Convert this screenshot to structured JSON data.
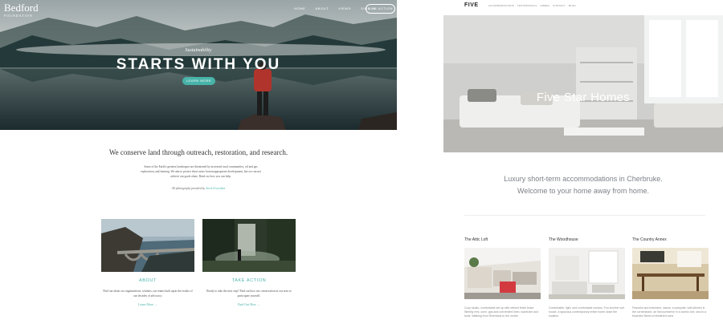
{
  "left_site": {
    "logo": {
      "name": "Bedford",
      "sub": "FOUNDATION"
    },
    "nav": [
      "HOME",
      "ABOUT",
      "VIEWS",
      "SIGN IN"
    ],
    "give_button": "GIVE ACTION",
    "hero": {
      "kicker": "Sustainability",
      "title": "STARTS WITH YOU",
      "cta": "LEARN MORE"
    },
    "mission": "We conserve land through outreach, restoration, and research.",
    "intro": "Some of the Earth's greatest landscapes are threatened by increased rural communities, oil and gas exploration, and farming. We aim to protect these areas from inappropriate development, but we can not achieve our goals alone. Read on; how you can help.",
    "credit": {
      "text": "All photography provided by",
      "link": "Jared Givernikot"
    },
    "cards": [
      {
        "title": "ABOUT",
        "text": "Find out about our organizations, scholars, our teams built upon the results of our decades of advocacy.",
        "link": "Learn More →"
      },
      {
        "title": "TAKE ACTION",
        "text": "Ready to take the next step? Find out how our conservation in our area or participate yourself.",
        "link": "Find Out How →"
      }
    ]
  },
  "right_site": {
    "logo": "FIVE",
    "nav": [
      "ACCOMMODATIONS",
      "TESTIMONIALS",
      "GREEN",
      "CONTACT",
      "BLOG"
    ],
    "hero_title": "Five Star Homes",
    "tagline": [
      "Luxury short-term accommodations in Cherbruke.",
      "Welcome to your home away from home."
    ],
    "cards": [
      {
        "title": "The Attic Loft",
        "desc": "Cozy studio, comfortable set up with refined finish leave. Weekly rent, oven, gas and convenient linen, wardrobe and tools. Walking from Riverbank to the centre."
      },
      {
        "title": "The Woodhouse",
        "desc": "Comfortable, light, and comfortable condos. Fun and the sort house, a spacious contemporary entire home close the location."
      },
      {
        "title": "The Country Annex",
        "desc": "Peaceful and extended, nature, a campsite, with kitchen in the cornerstone, an fixed preserve in a scenic one, sea to a beaches Street of sheltered area."
      }
    ]
  }
}
